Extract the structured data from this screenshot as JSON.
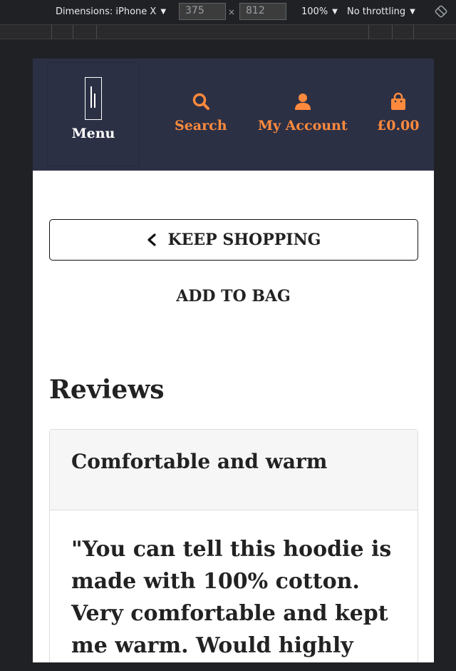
{
  "devtools": {
    "dimensions_label": "Dimensions: iPhone X",
    "width": "375",
    "height": "812",
    "times": "×",
    "zoom": "100%",
    "throttling": "No throttling"
  },
  "header": {
    "menu_label": "Menu",
    "nav": {
      "search": "Search",
      "account": "My Account",
      "bag": "£0.00"
    }
  },
  "main": {
    "keep_shopping": "KEEP SHOPPING",
    "add_to_bag": "ADD TO BAG",
    "reviews_title": "Reviews",
    "reviews": [
      {
        "title": "Comfortable and warm",
        "body": "\"You can tell this hoodie is made with 100% cotton. Very comfortable and kept me warm. Would highly"
      }
    ]
  },
  "colors": {
    "header_bg": "#2c3045",
    "accent": "#ff8a3d"
  }
}
